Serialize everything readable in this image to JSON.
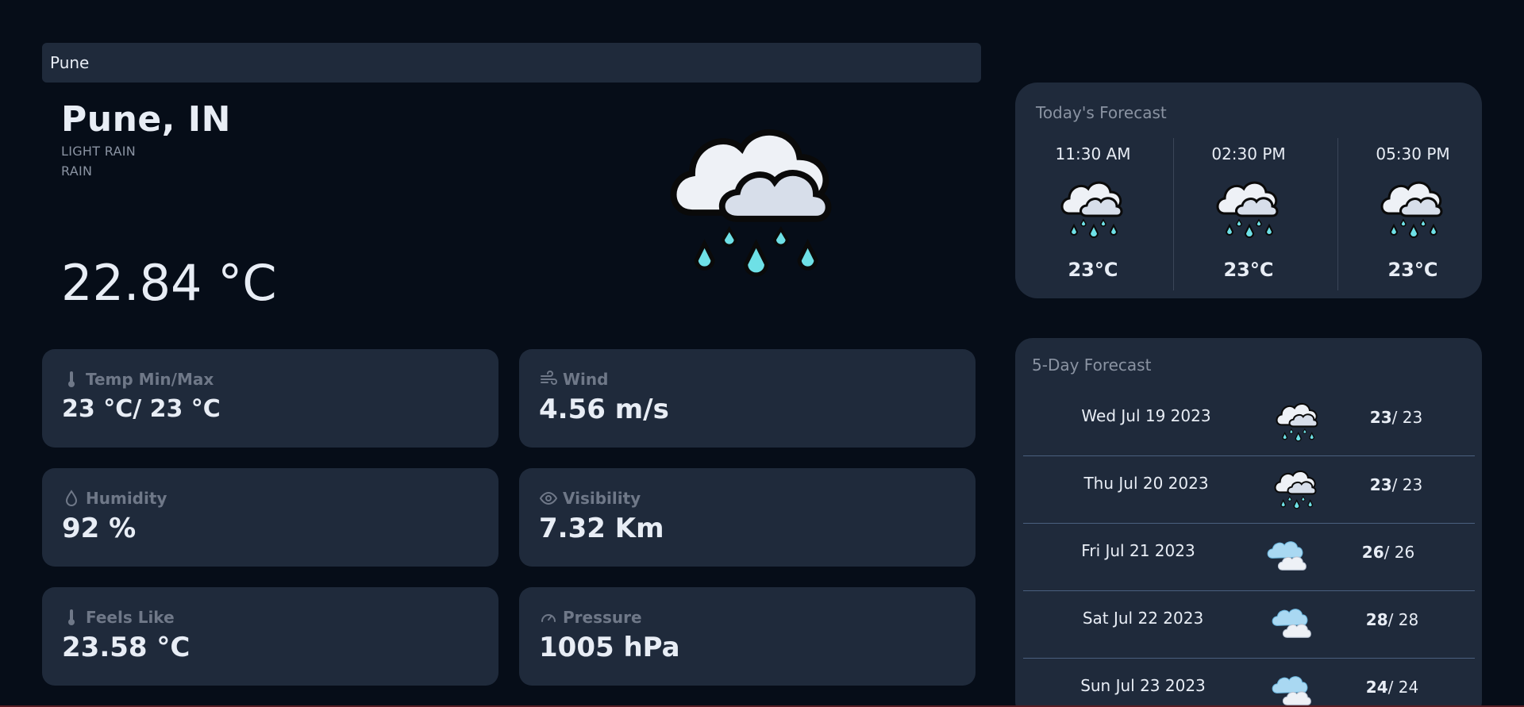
{
  "search": {
    "value": "Pune"
  },
  "current": {
    "city": "Pune, IN",
    "description": "LIGHT RAIN",
    "main": "RAIN",
    "temperature": "22.84 °C",
    "icon": "cloud-rain-icon"
  },
  "stats": {
    "temp_minmax": {
      "label": "Temp Min/Max",
      "value": "23 °C/ 23 °C",
      "icon": "thermometer-icon"
    },
    "wind": {
      "label": "Wind",
      "value": "4.56 m/s",
      "icon": "wind-icon"
    },
    "humidity": {
      "label": "Humidity",
      "value": "92 %",
      "icon": "droplet-icon"
    },
    "visibility": {
      "label": "Visibility",
      "value": "7.32 Km",
      "icon": "eye-icon"
    },
    "feels_like": {
      "label": "Feels Like",
      "value": "23.58 °C",
      "icon": "thermometer-icon"
    },
    "pressure": {
      "label": "Pressure",
      "value": "1005 hPa",
      "icon": "gauge-icon"
    }
  },
  "today": {
    "title": "Today's Forecast",
    "hours": [
      {
        "time": "11:30 AM",
        "temp": "23°C",
        "icon": "cloud-rain-icon"
      },
      {
        "time": "02:30 PM",
        "temp": "23°C",
        "icon": "cloud-rain-icon"
      },
      {
        "time": "05:30 PM",
        "temp": "23°C",
        "icon": "cloud-rain-icon"
      }
    ]
  },
  "five_day": {
    "title": "5-Day Forecast",
    "days": [
      {
        "date": "Wed Jul 19 2023",
        "max": "23",
        "min": "/ 23",
        "icon": "cloud-rain-icon"
      },
      {
        "date": "Thu Jul 20 2023",
        "max": "23",
        "min": "/ 23",
        "icon": "cloud-rain-icon"
      },
      {
        "date": "Fri Jul 21 2023",
        "max": "26",
        "min": "/ 26",
        "icon": "clouds-icon"
      },
      {
        "date": "Sat Jul 22 2023",
        "max": "28",
        "min": "/ 28",
        "icon": "clouds-icon"
      },
      {
        "date": "Sun Jul 23 2023",
        "max": "24",
        "min": "/ 24",
        "icon": "clouds-icon"
      }
    ]
  },
  "colors": {
    "background": "#060d18",
    "card": "#1f2a3b",
    "rain_drop": "#6ee0e6",
    "cloud_light": "#eef1f6",
    "cloud_blue": "#a9d8f2"
  }
}
